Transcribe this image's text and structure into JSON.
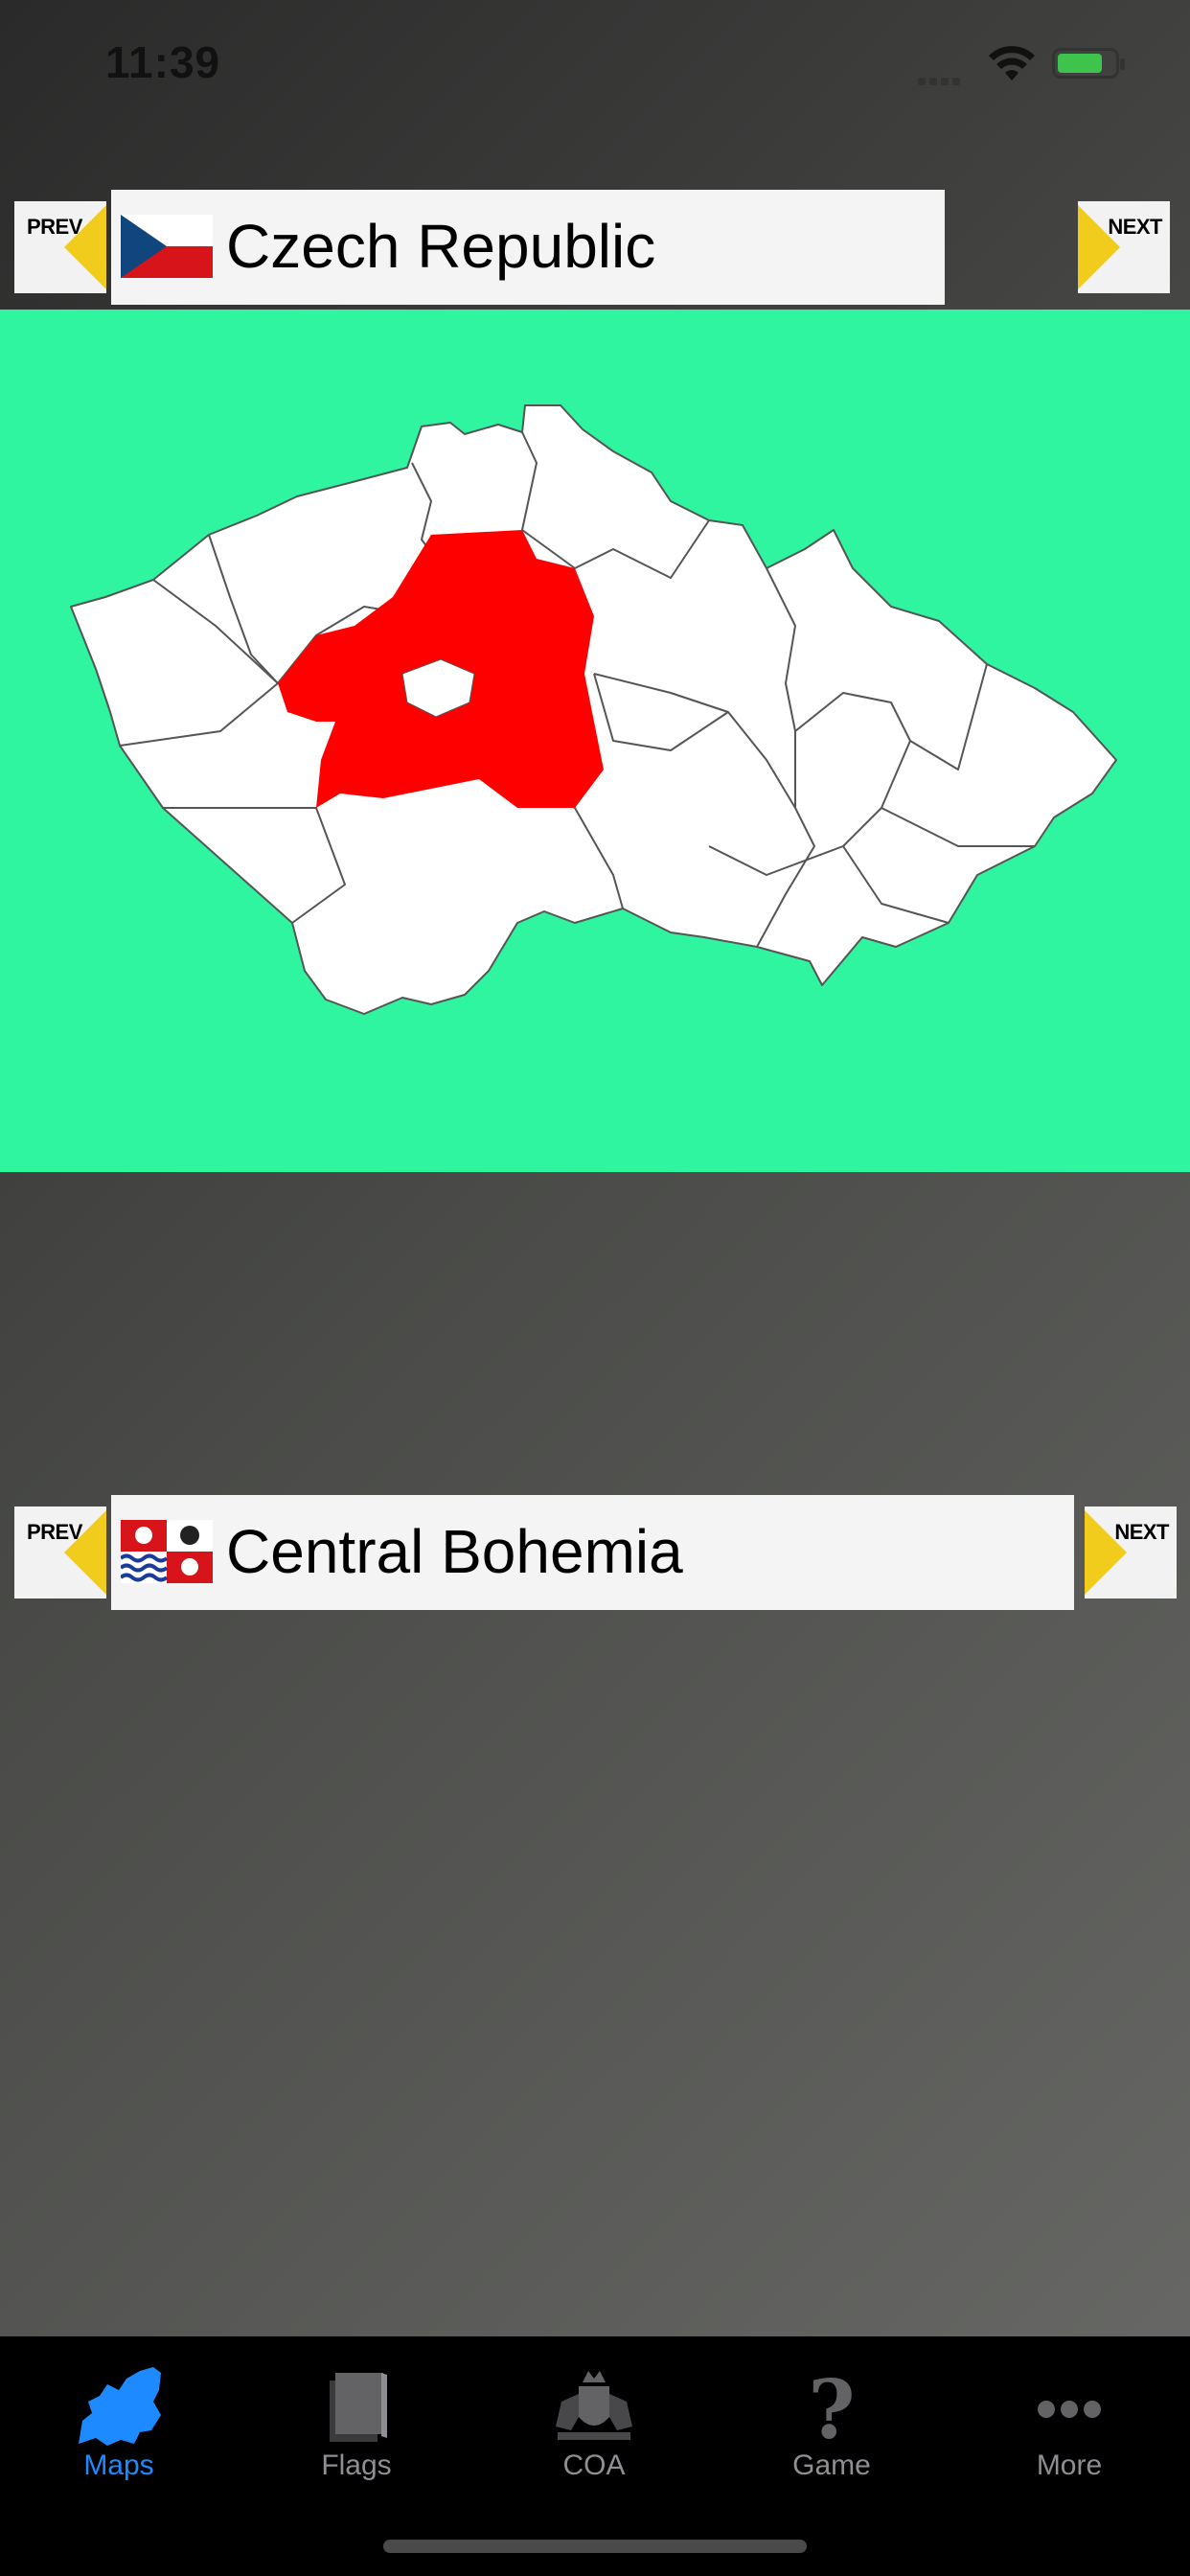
{
  "status": {
    "time": "11:39"
  },
  "top_nav": {
    "prev_label": "PREV",
    "next_label": "NEXT",
    "country_name": "Czech Republic",
    "flag_icon": "czech-flag-icon"
  },
  "map": {
    "background_color": "#2ff5a0",
    "highlight_color": "#ff0000",
    "highlighted_region": "Central Bohemia"
  },
  "bottom_nav": {
    "prev_label": "PREV",
    "next_label": "NEXT",
    "region_name": "Central Bohemia",
    "flag_icon": "central-bohemia-flag-icon"
  },
  "tabs": [
    {
      "label": "Maps",
      "icon": "europe-map-icon",
      "active": true
    },
    {
      "label": "Flags",
      "icon": "flags-book-icon",
      "active": false
    },
    {
      "label": "COA",
      "icon": "coat-of-arms-icon",
      "active": false
    },
    {
      "label": "Game",
      "icon": "question-icon",
      "active": false
    },
    {
      "label": "More",
      "icon": "more-dots-icon",
      "active": false
    }
  ],
  "colors": {
    "active_tab": "#1d8bff",
    "inactive_tab": "#8e8e93",
    "arrow_yellow": "#f2cc1c"
  }
}
